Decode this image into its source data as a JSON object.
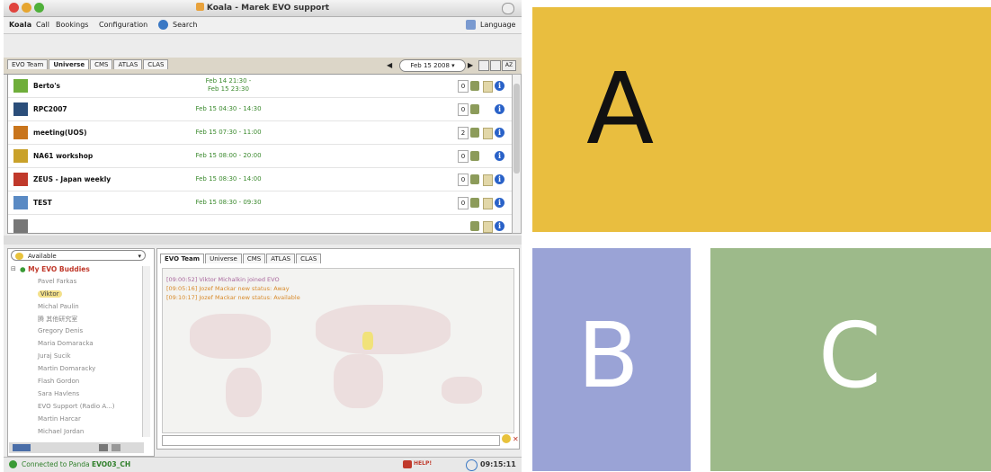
{
  "window": {
    "title": "Koala - Marek EVO support"
  },
  "menu": {
    "app": "Koala",
    "items": [
      "Call",
      "Bookings",
      "Configuration",
      "Search"
    ],
    "language": "Language"
  },
  "communities": {
    "tabs": [
      "EVO Team",
      "Universe",
      "CMS",
      "ATLAS",
      "CLAS"
    ],
    "active": "Universe"
  },
  "date_selector": {
    "value": "Feb 15 2008",
    "zoom_label": "AZ"
  },
  "meetings": [
    {
      "name": "Berto's",
      "time": "Feb 14 21:30 -\nFeb 15 23:30",
      "count": "0",
      "icon_color": "#6fae3a"
    },
    {
      "name": "RPC2007",
      "time": "Feb 15 04:30 - 14:30",
      "count": "0",
      "icon_color": "#2b4e7a"
    },
    {
      "name": "meeting(UOS)",
      "time": "Feb 15 07:30 - 11:00",
      "count": "2",
      "icon_color": "#c9751c"
    },
    {
      "name": "NA61 workshop",
      "time": "Feb 15 08:00 - 20:00",
      "count": "0",
      "icon_color": "#c9a12a"
    },
    {
      "name": "ZEUS - Japan weekly",
      "time": "Feb 15 08:30 - 14:00",
      "count": "0",
      "icon_color": "#c0392b"
    },
    {
      "name": "TEST",
      "time": "Feb 15 08:30 - 09:30",
      "count": "0",
      "icon_color": "#5a8ac4"
    }
  ],
  "presence": {
    "status": "Available",
    "group": "My EVO Buddies",
    "buddies": [
      "Pavel Farkas",
      "Viktor",
      "Michal Paulin",
      "腾 其他研究室",
      "Gregory Denis",
      "Maria Domaracka",
      "Juraj Sucik",
      "Martin Domaracky",
      "Flash Gordon",
      "Sara Havlens",
      "EVO Support (Radio A...)",
      "Martin Harcar",
      "Michael Jordan"
    ]
  },
  "chat": {
    "tabs": [
      "EVO Team",
      "Universe",
      "CMS",
      "ATLAS",
      "CLAS"
    ],
    "messages": [
      {
        "time": "[09:00:52]",
        "text": "Viktor Michalkin joined EVO",
        "color": "#a8669c"
      },
      {
        "time": "[09:05:16]",
        "text": "Jozef Mackar new status: Away",
        "color": "#d88a2a"
      },
      {
        "time": "[09:10:17]",
        "text": "Jozef Mackar new status: Available",
        "color": "#d88a2a"
      }
    ]
  },
  "status_bar": {
    "connection": "Connected to Panda",
    "server": "EVO03_CH",
    "help": "HELP!",
    "clock": "09:15:11"
  },
  "tiles": {
    "a": {
      "letter": "A",
      "color": "#e9be3f"
    },
    "b": {
      "letter": "B",
      "color": "#9aa3d6"
    },
    "c": {
      "letter": "C",
      "color": "#9dba8a"
    }
  }
}
